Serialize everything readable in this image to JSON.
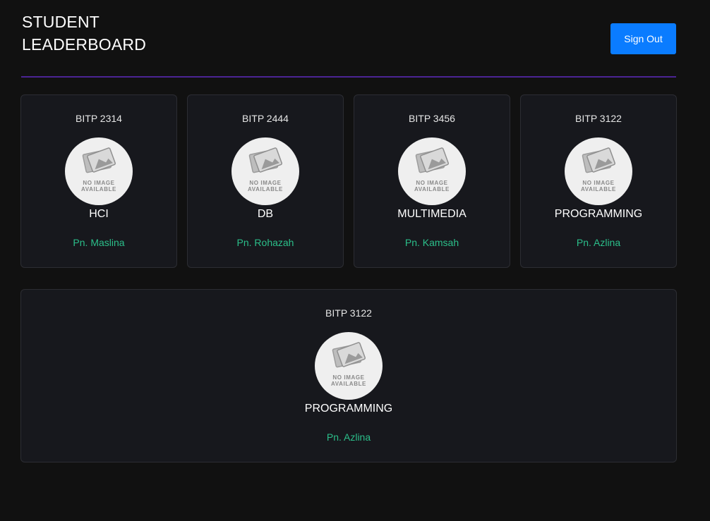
{
  "header": {
    "title_line1": "STUDENT",
    "title_line2": "LEADERBOARD",
    "signout_label": "Sign Out"
  },
  "colors": {
    "background": "#111111",
    "card": "#17181d",
    "accent_button": "#0a7cff",
    "divider": "#4b2494",
    "lecturer_text": "#2bbf8a"
  },
  "placeholder": {
    "line1": "NO IMAGE",
    "line2": "AVAILABLE",
    "icon": "image-placeholder-icon"
  },
  "courses": [
    {
      "code": "BITP 2314",
      "name": "HCI",
      "lecturer": "Pn. Maslina"
    },
    {
      "code": "BITP 2444",
      "name": "DB",
      "lecturer": "Pn. Rohazah"
    },
    {
      "code": "BITP 3456",
      "name": "MULTIMEDIA",
      "lecturer": "Pn. Kamsah"
    },
    {
      "code": "BITP 3122",
      "name": "PROGRAMMING",
      "lecturer": "Pn. Azlina"
    },
    {
      "code": "BITP 3122",
      "name": "PROGRAMMING",
      "lecturer": "Pn. Azlina"
    }
  ]
}
